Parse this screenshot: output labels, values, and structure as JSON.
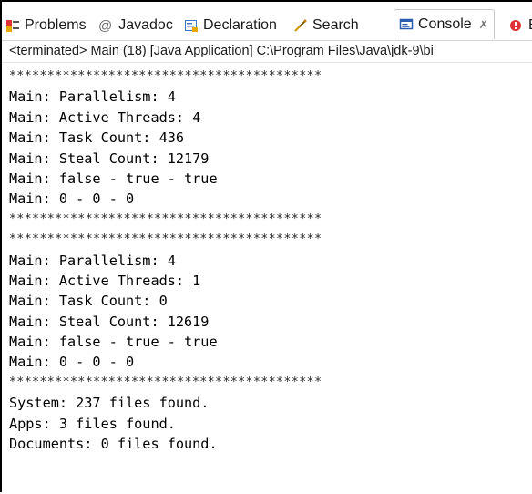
{
  "tabs": [
    {
      "label": "Problems",
      "icon": "problems-icon"
    },
    {
      "label": "Javadoc",
      "icon": "javadoc-icon",
      "prefix": "@"
    },
    {
      "label": "Declaration",
      "icon": "declaration-icon"
    },
    {
      "label": "Search",
      "icon": "search-icon"
    },
    {
      "label": "Console",
      "icon": "console-icon",
      "active": true,
      "close": "✗"
    },
    {
      "label": "Er",
      "icon": "error-log-icon"
    }
  ],
  "status": "<terminated> Main (18) [Java Application] C:\\Program Files\\Java\\jdk-9\\bi",
  "console_lines": [
    "*****************************************",
    "Main: Parallelism: 4",
    "Main: Active Threads: 4",
    "Main: Task Count: 436",
    "Main: Steal Count: 12179",
    "Main: false - true - true",
    "Main: 0 - 0 - 0",
    "*****************************************",
    "*****************************************",
    "Main: Parallelism: 4",
    "Main: Active Threads: 1",
    "Main: Task Count: 0",
    "Main: Steal Count: 12619",
    "Main: false - true - true",
    "Main: 0 - 0 - 0",
    "*****************************************",
    "System: 237 files found.",
    "Apps: 3 files found.",
    "Documents: 0 files found."
  ],
  "colors": {
    "accent": "#2a5db0",
    "border": "#000000"
  }
}
